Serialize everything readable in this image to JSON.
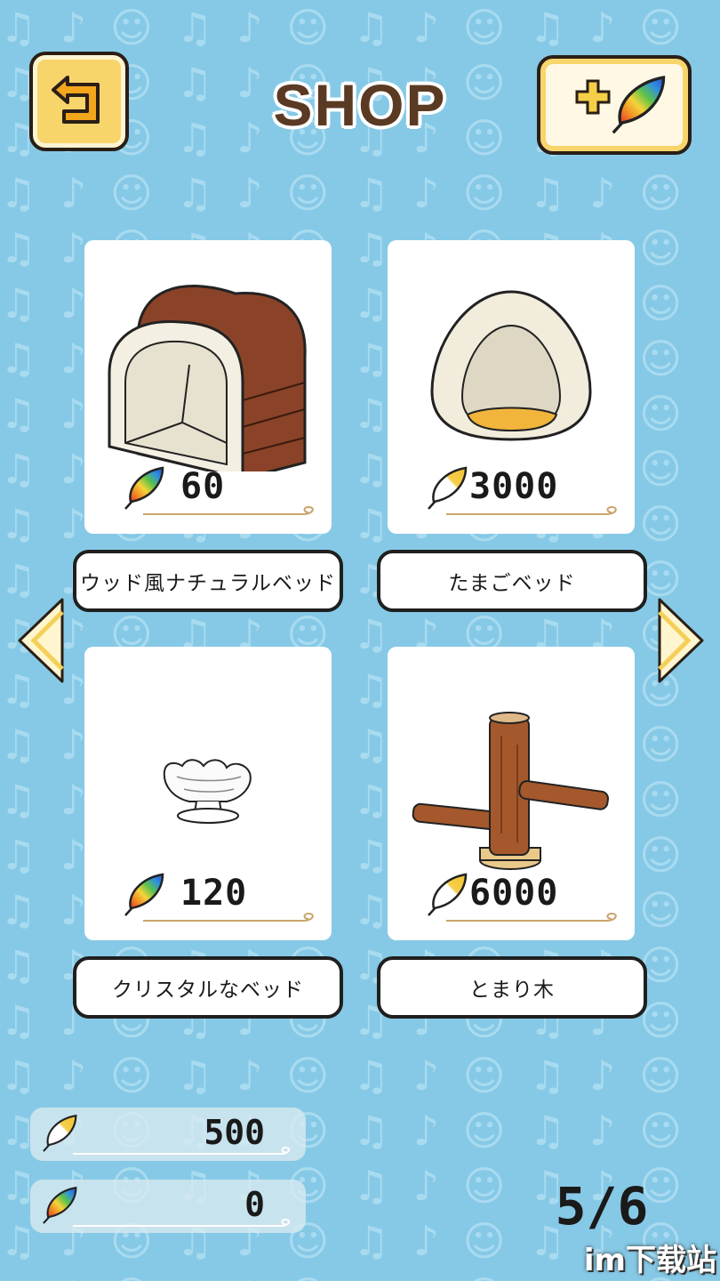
{
  "header": {
    "title": "SHOP",
    "back_icon": "back-arrow-icon",
    "add_feathers_icon": "plus-rainbow-feather-icon"
  },
  "items": [
    {
      "name": "ウッド風ナチュラルベッド",
      "price": "60",
      "currency": "rainbow-feather",
      "art": "wooden-tunnel-bed"
    },
    {
      "name": "たまごベッド",
      "price": "3000",
      "currency": "yellow-feather",
      "art": "egg-bed"
    },
    {
      "name": "クリスタルなベッド",
      "price": "120",
      "currency": "rainbow-feather",
      "art": "crystal-bowl-bed"
    },
    {
      "name": "とまり木",
      "price": "6000",
      "currency": "yellow-feather",
      "art": "wooden-perch"
    }
  ],
  "balances": {
    "yellow_feathers": "500",
    "rainbow_feathers": "0"
  },
  "pagination": {
    "page": "5/6",
    "prev_icon": "left-triangle-icon",
    "next_icon": "right-triangle-icon"
  },
  "watermark": "im下载站",
  "colors": {
    "background": "#86c9e6",
    "button_yellow": "#f8d56b",
    "title_brown": "#5a3a22"
  }
}
